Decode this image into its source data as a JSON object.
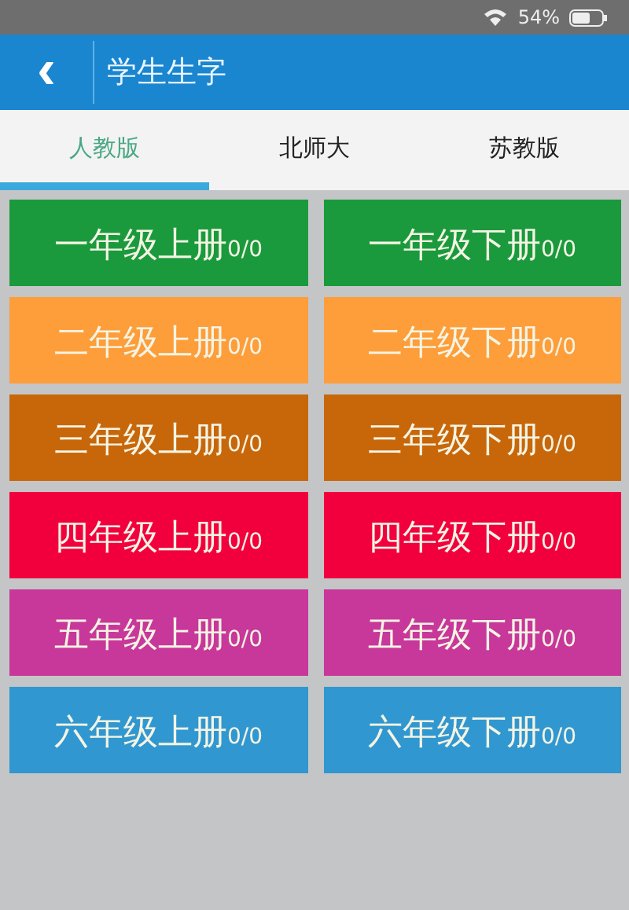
{
  "status_bar": {
    "battery": "54%"
  },
  "header": {
    "back": "‹",
    "title": "学生生字"
  },
  "tabs": [
    {
      "label": "人教版",
      "selected": true
    },
    {
      "label": "北师大",
      "selected": false
    },
    {
      "label": "苏教版",
      "selected": false
    }
  ],
  "books": [
    {
      "label": "一年级上册",
      "count": "0/0",
      "color": "#1a9a3c"
    },
    {
      "label": "一年级下册",
      "count": "0/0",
      "color": "#1a9a3c"
    },
    {
      "label": "二年级上册",
      "count": "0/0",
      "color": "#fd9e3a"
    },
    {
      "label": "二年级下册",
      "count": "0/0",
      "color": "#fd9e3a"
    },
    {
      "label": "三年级上册",
      "count": "0/0",
      "color": "#c8670a"
    },
    {
      "label": "三年级下册",
      "count": "0/0",
      "color": "#c8670a"
    },
    {
      "label": "四年级上册",
      "count": "0/0",
      "color": "#f2003e"
    },
    {
      "label": "四年级下册",
      "count": "0/0",
      "color": "#f2003e"
    },
    {
      "label": "五年级上册",
      "count": "0/0",
      "color": "#c8379a"
    },
    {
      "label": "五年级下册",
      "count": "0/0",
      "color": "#c8379a"
    },
    {
      "label": "六年级上册",
      "count": "0/0",
      "color": "#3197d0"
    },
    {
      "label": "六年级下册",
      "count": "0/0",
      "color": "#3197d0"
    }
  ]
}
